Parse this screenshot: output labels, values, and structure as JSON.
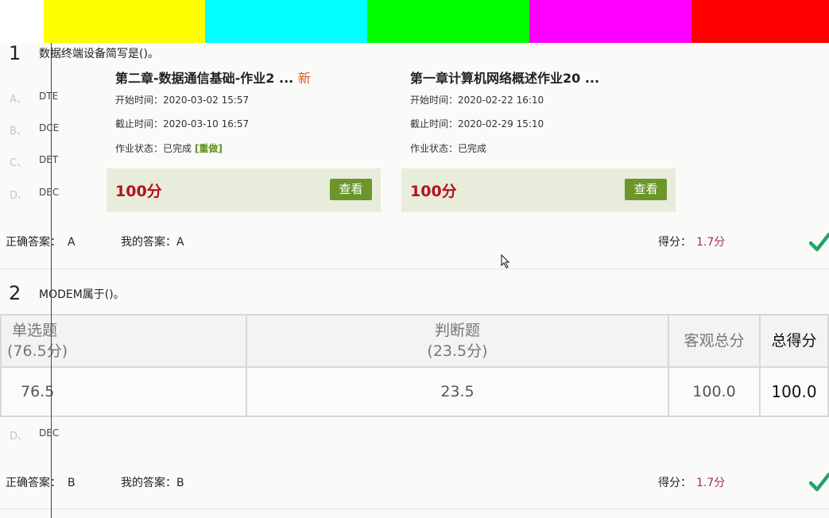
{
  "color_bars": [
    "#ffffff",
    "#ffff00",
    "#00ffff",
    "#00ff00",
    "#ff00ff",
    "#ff0000"
  ],
  "q1": {
    "number": "1",
    "question": "数据终端设备简写是()。",
    "options": [
      {
        "letter": "A、",
        "text": "DTE"
      },
      {
        "letter": "B、",
        "text": "DCE"
      },
      {
        "letter": "C、",
        "text": "DET"
      },
      {
        "letter": "D、",
        "text": "DEC"
      }
    ],
    "correct_label": "正确答案：",
    "correct_value": "A",
    "my_label": "我的答案：",
    "my_value": "A",
    "score_label": "得分：",
    "score_value": "1.7分"
  },
  "cards": [
    {
      "title": "第二章-数据通信基础-作业2 ...",
      "new_tag": "新",
      "start_label": "开始时间：",
      "start_value": "2020-03-02 15:57",
      "end_label": "截止时间：",
      "end_value": "2020-03-10 16:57",
      "status_label": "作业状态：",
      "status_value": "已完成",
      "redo_label": "[重做]",
      "score": "100分",
      "view_label": "查看"
    },
    {
      "title": "第一章计算机网络概述作业20 ...",
      "start_label": "开始时间：",
      "start_value": "2020-02-22 16:10",
      "end_label": "截止时间：",
      "end_value": "2020-02-29 15:10",
      "status_label": "作业状态：",
      "status_value": "已完成",
      "score": "100分",
      "view_label": "查看"
    }
  ],
  "q2": {
    "number": "2",
    "question": "MODEM属于()。",
    "options": [
      {
        "letter": "D、",
        "text": "DEC"
      }
    ],
    "correct_label": "正确答案：",
    "correct_value": "B",
    "my_label": "我的答案：",
    "my_value": "B",
    "score_label": "得分：",
    "score_value": "1.7分"
  },
  "summary": {
    "headers": {
      "single_line1": "单选题",
      "single_line2": "(76.5分)",
      "judge_line1": "判断题",
      "judge_line2": "(23.5分)",
      "objective": "客观总分",
      "total": "总得分"
    },
    "values": {
      "single": "76.5",
      "judge": "23.5",
      "objective": "100.0",
      "total": "100.0"
    }
  },
  "colors": {
    "score_red": "#b3131b",
    "button_green": "#6c952c",
    "card_footer": "#e8ecda",
    "check_green": "#1fa665"
  }
}
